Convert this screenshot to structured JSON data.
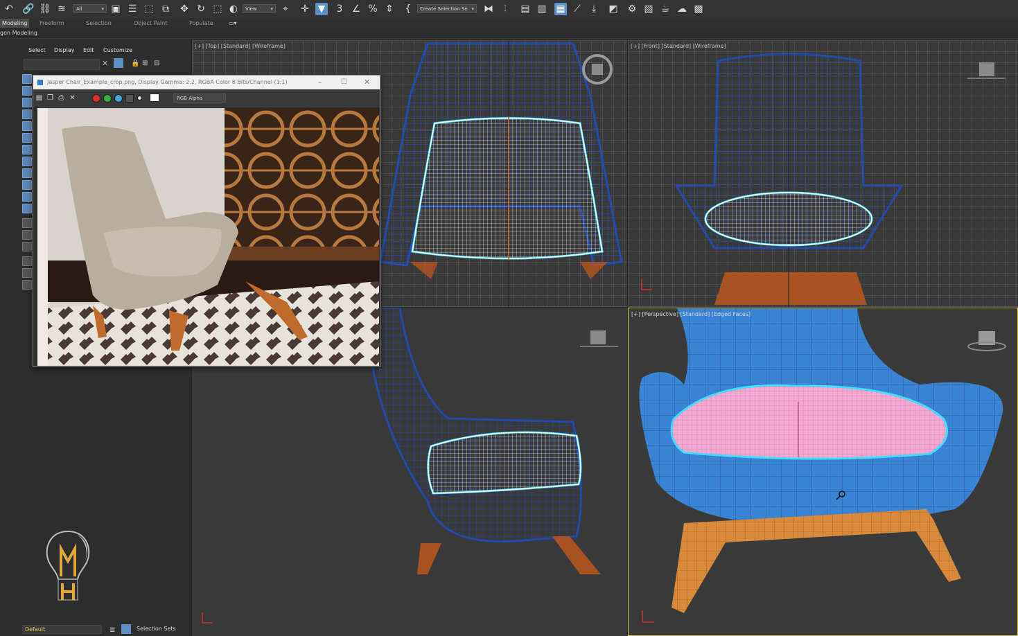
{
  "toolbar": {
    "selection_filter": "All",
    "reference_coord": "View",
    "named_selection_set": "Create Selection Se",
    "icons": [
      "undo-icon",
      "link-icon",
      "unlink-icon",
      "bind-spacewarp-icon",
      "select-object-icon",
      "select-by-name-icon",
      "rect-selection-icon",
      "window-crossing-icon",
      "move-icon",
      "rotate-icon",
      "scale-icon",
      "placement-icon",
      "pivot-icon",
      "select-manipulate-icon",
      "snap-3d-icon",
      "angle-snap-icon",
      "percent-snap-icon",
      "spinner-snap-icon",
      "edit-named-sets-icon",
      "mirror-icon",
      "align-icon",
      "scene-explorer-icon",
      "layer-explorer-icon",
      "ribbon-toggle-icon",
      "curve-editor-icon",
      "schematic-view-icon",
      "material-editor-icon",
      "render-setup-icon",
      "rendered-frame-icon",
      "render-icon",
      "render-cloud-icon",
      "a360-icon"
    ]
  },
  "ribbon": {
    "tabs": [
      "Modeling",
      "Freeform",
      "Selection",
      "Object Paint",
      "Populate"
    ],
    "active_tab": "Modeling",
    "sub_label": "gon Modeling"
  },
  "scene_explorer": {
    "menu": [
      "Select",
      "Display",
      "Edit",
      "Customize"
    ]
  },
  "frame_window": {
    "title": "Jasper Chair_Example_crop.png, Display Gamma: 2.2, RGBA Color 8 Bits/Channel (1:1)",
    "channel": "RGB Alpha",
    "channel_colors": [
      "#e0302c",
      "#35b24a",
      "#3ea8dd",
      "#ffffff"
    ]
  },
  "viewports": {
    "top": {
      "label": "[+] [Top] [Standard] [Wireframe]"
    },
    "front": {
      "label": "[+] [Front] [Standard] [Wireframe]"
    },
    "left": {
      "label": ""
    },
    "perspective": {
      "label": "[+] [Perspective] [Standard] [Edged Faces]"
    }
  },
  "status": {
    "layer": "Default",
    "selection_sets": "Selection Sets"
  },
  "colors": {
    "wire_blue": "#1f4fbf",
    "wire_orange": "#b5541f",
    "selection_white": "#ffffff",
    "selection_cyan": "#3fe0ff",
    "chair_blue": "#3b84d4",
    "cushion_pink": "#f2a7d0",
    "wood": "#d9893a",
    "active_blue": "#5c8fc2"
  }
}
